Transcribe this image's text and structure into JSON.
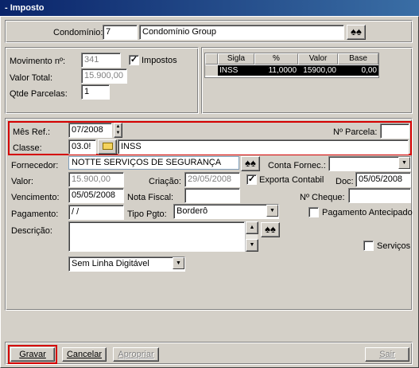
{
  "window": {
    "title": "- Imposto"
  },
  "top": {
    "condominio_label": "Condomínio:",
    "condominio_code": "7",
    "condominio_name": "Condomínio Group"
  },
  "info": {
    "movimento_label": "Movimento nº:",
    "movimento_value": "341",
    "valor_total_label": "Valor Total:",
    "valor_total_value": "15.900,00",
    "qtde_parcelas_label": "Qtde Parcelas:",
    "qtde_parcelas_value": "1",
    "impostos_label": "Impostos",
    "impostos_checked": true
  },
  "tax_grid": {
    "columns": [
      "Sigla",
      "%",
      "Valor",
      "Base"
    ],
    "rows": [
      {
        "sigla": "INSS",
        "pct": "11,0000",
        "valor": "15900,00",
        "base": "0,00"
      }
    ]
  },
  "ref": {
    "mes_ref_label": "Mês Ref.:",
    "mes_ref_value": "07/2008",
    "parcela_label": "Nº Parcela:",
    "parcela_value": "",
    "classe_label": "Classe:",
    "classe_code": "03.0!",
    "classe_name": "INSS"
  },
  "form": {
    "fornecedor_label": "Fornecedor:",
    "fornecedor_value": "NOTTE SERVIÇOS DE SEGURANÇA",
    "conta_fornec_label": "Conta Fornec.:",
    "conta_fornec_value": "",
    "valor_label": "Valor:",
    "valor_value": "15.900,00",
    "criacao_label": "Criação:",
    "criacao_value": "29/05/2008",
    "exporta_label": "Exporta Contabil",
    "exporta_checked": true,
    "doc_label": "Doc:",
    "doc_value": "05/05/2008",
    "vencimento_label": "Vencimento:",
    "vencimento_value": "05/05/2008",
    "nota_fiscal_label": "Nota Fiscal:",
    "nota_fiscal_value": "",
    "cheque_label": "Nº Cheque:",
    "cheque_value": "",
    "pagamento_label": "Pagamento:",
    "pagamento_value": " /  /",
    "tipo_pgto_label": "Tipo Pgto:",
    "tipo_pgto_value": "Borderô",
    "pag_antecipado_label": "Pagamento Antecipado",
    "pag_antecipado_checked": false,
    "descricao_label": "Descrição:",
    "descricao_value": "",
    "servicos_label": "Serviços",
    "servicos_checked": false,
    "linha_digitavel_value": "Sem Linha Digitável"
  },
  "buttons": {
    "gravar": "Gravar",
    "cancelar": "Cancelar",
    "apropriar": "Apropriar",
    "sair": "Sair"
  },
  "colors": {
    "highlight_border": "#d40000",
    "title_start": "#0a246a",
    "title_end": "#3a6ea5"
  },
  "icons": {
    "search": "binoculars-icon",
    "folder": "folder-icon"
  }
}
